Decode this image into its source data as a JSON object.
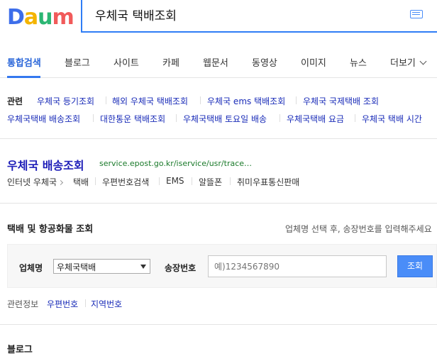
{
  "header": {
    "logo": [
      "D",
      "a",
      "u",
      "m"
    ],
    "logo_colors": [
      "#3d6eea",
      "#f4b400",
      "#2bb673",
      "#f15a5a"
    ],
    "query": "우체국 택배조회"
  },
  "tabs": {
    "items": [
      "통합검색",
      "블로그",
      "사이트",
      "카페",
      "웹문서",
      "동영상",
      "이미지",
      "뉴스"
    ],
    "more": "더보기"
  },
  "related": {
    "label": "관련",
    "row1": [
      "우체국 등기조회",
      "해외 우체국 택배조회",
      "우체국 ems 택배조회",
      "우체국 국제택배 조회"
    ],
    "row2": [
      "우체국택배 배송조회",
      "대한통운 택배조회",
      "우체국택배 토요일 배송",
      "우체국택배 요금",
      "우체국 택배 시간"
    ]
  },
  "result": {
    "title": "우체국 배송조회",
    "url": "service.epost.go.kr/iservice/usr/trace…",
    "crumb": "인터넷 우체국",
    "links": [
      "택배",
      "우편번호검색",
      "EMS",
      "알뜰폰",
      "취미우표통신판매"
    ]
  },
  "parcel": {
    "title": "택배 및 항공화물 조회",
    "hint": "업체명 선택 후, 송장번호를 입력해주세요",
    "carrier_label": "업체명",
    "carrier_value": "우체국택배",
    "tracking_label": "송장번호",
    "tracking_placeholder": "예)1234567890",
    "submit": "조회",
    "info_label": "관련정보",
    "info_links": [
      "우편번호",
      "지역번호"
    ]
  },
  "next_section": "블로그"
}
